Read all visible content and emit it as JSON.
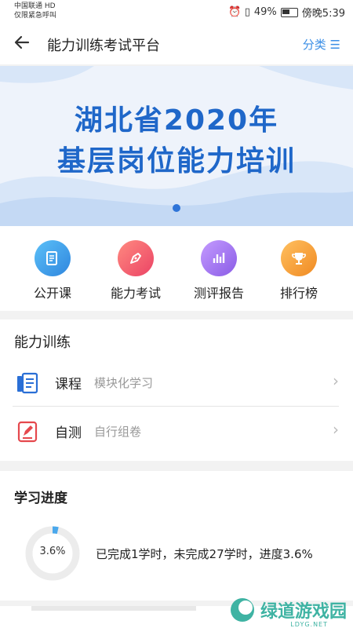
{
  "status_bar": {
    "carrier_line1": "中国联通 HD",
    "carrier_line2": "仅限紧急呼叫",
    "alarm_vibrate": "⏰ ▯",
    "battery_pct": "49%",
    "time": "傍晚5:39"
  },
  "header": {
    "back_icon": "arrow-left-icon",
    "title": "能力训练考试平台",
    "category_label": "分类 ☰"
  },
  "banner": {
    "line1": "湖北省2020年",
    "line2": "基层岗位能力培训",
    "colors": {
      "text": "#1f67c9",
      "bg": "#eef3fb",
      "wave": "#cfe0f7"
    }
  },
  "quick_menu": [
    {
      "label": "公开课",
      "icon": "edit-document-icon",
      "color": "#3aa0e8"
    },
    {
      "label": "能力考试",
      "icon": "pen-icon",
      "color": "#f0566a"
    },
    {
      "label": "测评报告",
      "icon": "bar-chart-icon",
      "color": "#9a6be6"
    },
    {
      "label": "排行榜",
      "icon": "trophy-icon",
      "color": "#f59a2e"
    }
  ],
  "training": {
    "title": "能力训练",
    "items": [
      {
        "label": "课程",
        "desc": "模块化学习",
        "icon": "course-icon"
      },
      {
        "label": "自测",
        "desc": "自行组卷",
        "icon": "self-test-icon"
      }
    ]
  },
  "progress": {
    "title": "学习进度",
    "percent_label": "3.6%",
    "percent": 3.6,
    "summary": "已完成1学时，未完成27学时，进度3.6%"
  },
  "watermark": {
    "name": "绿道游戏园",
    "sub": "LDYG.NET"
  }
}
